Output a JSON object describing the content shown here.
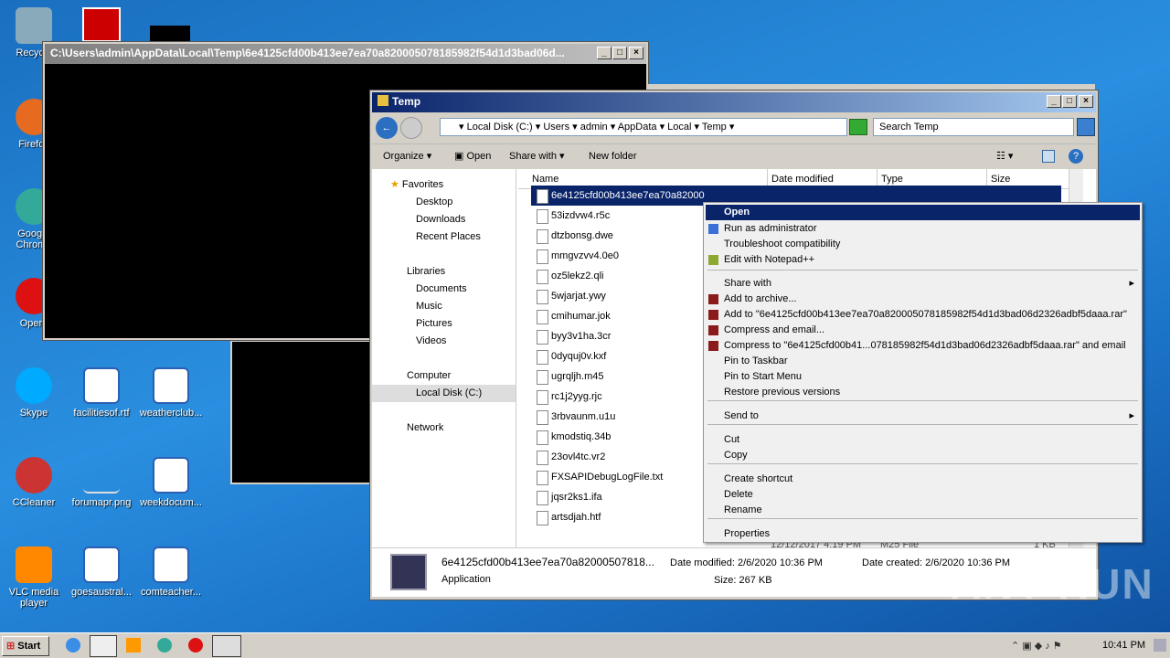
{
  "desktop": {
    "icons": [
      {
        "label": "Recycle",
        "color": "#8ab"
      },
      {
        "label": "Firefox",
        "color": "#e66a1f"
      },
      {
        "label": "Google Chrome",
        "color": "#3a9"
      },
      {
        "label": "Opera",
        "color": "#d11"
      },
      {
        "label": "Skype",
        "color": "#0af"
      },
      {
        "label": "CCleaner",
        "color": "#c33"
      },
      {
        "label": "VLC media player",
        "color": "#f80"
      },
      {
        "label": "facilitiesof.rtf",
        "color": "#2b5fb3"
      },
      {
        "label": "weatherclub...",
        "color": "#2b5fb3"
      },
      {
        "label": "forumapr.png",
        "color": "#ddd"
      },
      {
        "label": "weekdocum...",
        "color": "#2b5fb3"
      },
      {
        "label": "goesaustral...",
        "color": "#2b5fb3"
      },
      {
        "label": "comteacher...",
        "color": "#2b5fb3"
      }
    ]
  },
  "cmd": {
    "title": "C:\\Users\\admin\\AppData\\Local\\Temp\\6e4125cfd00b413ee7ea70a820005078185982f54d1d3bad06d..."
  },
  "explorer": {
    "title": "Temp",
    "breadcrumb": [
      "Local Disk (C:)",
      "Users",
      "admin",
      "AppData",
      "Local",
      "Temp"
    ],
    "search_placeholder": "Search Temp",
    "toolbar": {
      "organize": "Organize",
      "open": "Open",
      "share": "Share with",
      "new_folder": "New folder"
    },
    "nav": {
      "favorites": "Favorites",
      "desktop": "Desktop",
      "downloads": "Downloads",
      "recent": "Recent Places",
      "libraries": "Libraries",
      "documents": "Documents",
      "music": "Music",
      "pictures": "Pictures",
      "videos": "Videos",
      "computer": "Computer",
      "local_disk": "Local Disk (C:)",
      "network": "Network"
    },
    "columns": {
      "name": "Name",
      "date": "Date modified",
      "type": "Type",
      "size": "Size"
    },
    "files": [
      "6e4125cfd00b413ee7ea70a82000",
      "53izdvw4.r5c",
      "dtzbonsg.dwe",
      "mmgvzvv4.0e0",
      "oz5lekz2.qli",
      "5wjarjat.ywy",
      "cmihumar.jok",
      "byy3v1ha.3cr",
      "0dyquj0v.kxf",
      "ugrqljh.m45",
      "rc1j2yyg.rjc",
      "3rbvaunm.u1u",
      "kmodstiq.34b",
      "23ovl4tc.vr2",
      "FXSAPIDebugLogFile.txt",
      "jqsr2ks1.ifa",
      "artsdjah.htf"
    ],
    "partial_row": {
      "date": "12/12/2017 4:19 PM",
      "type": "M25 File",
      "size": "1 KB"
    },
    "details": {
      "name": "6e4125cfd00b413ee7ea70a82000507818...",
      "type": "Application",
      "modified": "Date modified: 2/6/2020 10:36 PM",
      "size": "Size: 267 KB",
      "created": "Date created: 2/6/2020 10:36 PM"
    }
  },
  "context_menu": {
    "items": [
      "Open",
      "Run as administrator",
      "Troubleshoot compatibility",
      "Edit with Notepad++",
      "Share with",
      "Add to archive...",
      "Add to \"6e4125cfd00b413ee7ea70a820005078185982f54d1d3bad06d2326adbf5daaa.rar\"",
      "Compress and email...",
      "Compress to \"6e4125cfd00b41...078185982f54d1d3bad06d2326adbf5daaa.rar\" and email",
      "Pin to Taskbar",
      "Pin to Start Menu",
      "Restore previous versions",
      "Send to",
      "Cut",
      "Copy",
      "Create shortcut",
      "Delete",
      "Rename",
      "Properties"
    ]
  },
  "taskbar": {
    "start": "Start",
    "clock": "10:41 PM"
  },
  "watermark": "ANY RUN"
}
